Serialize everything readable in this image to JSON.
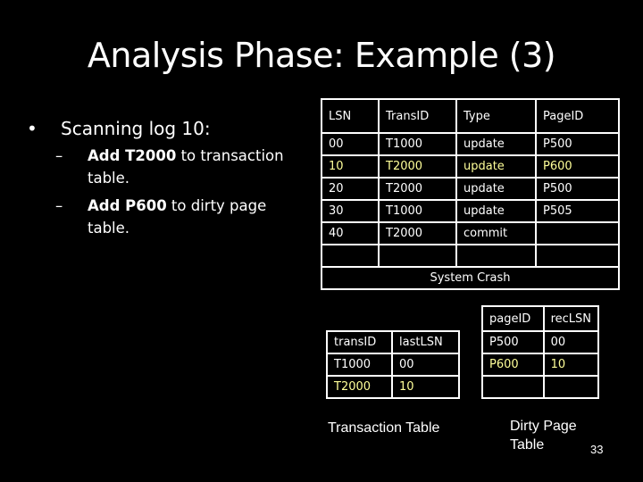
{
  "slide": {
    "title": "Analysis Phase: Example (3)",
    "page_number": "33",
    "highlight_color": "#ffff99"
  },
  "bullets": {
    "main": "Scanning log 10:",
    "subs": [
      {
        "bold": "Add T2000",
        "rest": " to transaction table."
      },
      {
        "bold": "Add P600",
        "rest": " to dirty page table."
      }
    ]
  },
  "log_table": {
    "headers": [
      "LSN",
      "TransID",
      "Type",
      "PageID"
    ],
    "rows": [
      [
        "00",
        "T1000",
        "update",
        "P500"
      ],
      [
        "10",
        "T2000",
        "update",
        "P600"
      ],
      [
        "20",
        "T2000",
        "update",
        "P500"
      ],
      [
        "30",
        "T1000",
        "update",
        "P505"
      ],
      [
        "40",
        "T2000",
        "commit",
        ""
      ],
      [
        "",
        "",
        "",
        ""
      ]
    ],
    "highlighted_row": 1,
    "footer": "System Crash"
  },
  "transaction_table": {
    "caption": "Transaction Table",
    "headers": [
      "transID",
      "lastLSN"
    ],
    "rows": [
      [
        "T1000",
        "00"
      ],
      [
        "T2000",
        "10"
      ]
    ],
    "highlighted_row": 1
  },
  "dirty_page_table": {
    "caption_line1": "Dirty Page",
    "caption_line2": "Table",
    "headers": [
      "pageID",
      "recLSN"
    ],
    "rows": [
      [
        "P500",
        "00"
      ],
      [
        "P600",
        "10"
      ],
      [
        "",
        ""
      ]
    ],
    "highlighted_row": 1
  }
}
